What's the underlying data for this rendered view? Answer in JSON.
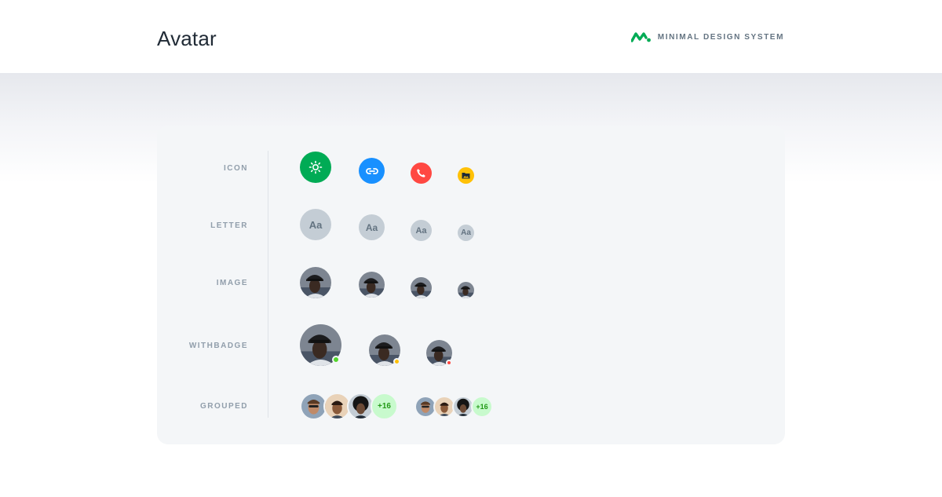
{
  "header": {
    "title": "Avatar",
    "brand": {
      "name": "MINIMAL DESIGN SYSTEM",
      "logo_icon": "minimal-logo-icon",
      "color": "#00ab55"
    }
  },
  "rows": {
    "icon": "ICON",
    "letter": "LETTER",
    "image": "IMAGE",
    "withbadge": "WITHBADGE",
    "grouped": "GROUPED"
  },
  "icon_avatars": [
    {
      "icon": "sun-icon",
      "color": "#00ab55"
    },
    {
      "icon": "link-icon",
      "color": "#1890ff"
    },
    {
      "icon": "phone-icon",
      "color": "#ff4842"
    },
    {
      "icon": "folder-image-icon",
      "color": "#ffc107"
    }
  ],
  "letter_avatars": [
    "Aa",
    "Aa",
    "Aa",
    "Aa"
  ],
  "badges": {
    "online": "#54d62c",
    "away": "#ffc107",
    "busy": "#ff4842"
  },
  "grouped": {
    "more_large": "+16",
    "more_small": "+16"
  }
}
